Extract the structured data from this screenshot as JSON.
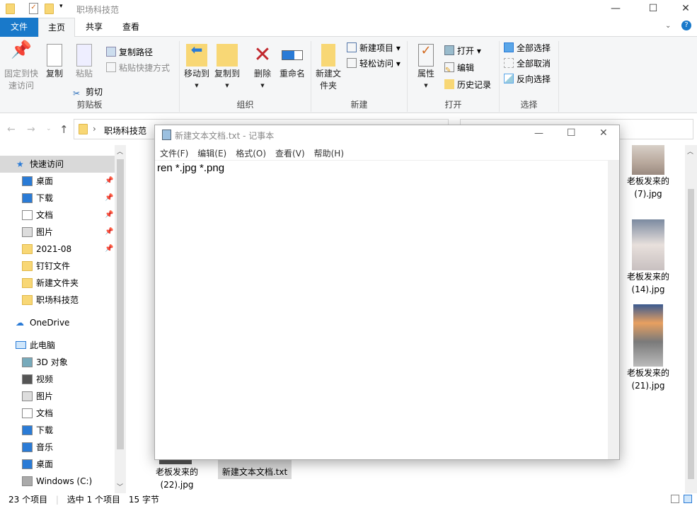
{
  "window": {
    "title": "职场科技范",
    "minimize": "—",
    "maximize": "☐",
    "close": "✕"
  },
  "tabs": [
    "文件",
    "主页",
    "共享",
    "查看"
  ],
  "ribbon": {
    "clipboard": {
      "label": "剪贴板",
      "pin": "固定到快速访问",
      "copy": "复制",
      "paste": "粘贴",
      "copy_path": "复制路径",
      "paste_shortcut": "粘贴快捷方式",
      "cut": "剪切"
    },
    "organize": {
      "label": "组织",
      "move_to": "移动到",
      "copy_to": "复制到",
      "delete": "删除",
      "rename": "重命名"
    },
    "new": {
      "label": "新建",
      "new_folder": "新建文件夹",
      "new_item": "新建项目",
      "easy_access": "轻松访问"
    },
    "open": {
      "label": "打开",
      "properties": "属性",
      "open": "打开",
      "edit": "编辑",
      "history": "历史记录"
    },
    "select": {
      "label": "选择",
      "select_all": "全部选择",
      "select_none": "全部取消",
      "invert": "反向选择"
    }
  },
  "address": {
    "path": "职场科技范"
  },
  "nav": {
    "quick_access": "快速访问",
    "quick_items": [
      {
        "label": "桌面",
        "pinned": true
      },
      {
        "label": "下载",
        "pinned": true
      },
      {
        "label": "文档",
        "pinned": true
      },
      {
        "label": "图片",
        "pinned": true
      },
      {
        "label": "2021-08",
        "pinned": true
      },
      {
        "label": "钉钉文件"
      },
      {
        "label": "新建文件夹"
      },
      {
        "label": "职场科技范"
      }
    ],
    "onedrive": "OneDrive",
    "this_pc": "此电脑",
    "pc_items": [
      "3D 对象",
      "视频",
      "图片",
      "文档",
      "下载",
      "音乐",
      "桌面",
      "Windows (C:)"
    ]
  },
  "files": [
    {
      "name1": "老板发来的",
      "name2": "(7).jpg"
    },
    {
      "name1": "老板发来的",
      "name2": "(14).jpg"
    },
    {
      "name1": "老板发来的",
      "name2": "(21).jpg"
    },
    {
      "name1": "老板发来的",
      "name2": "(22).jpg"
    },
    {
      "name1": "新建文本文档.txt"
    }
  ],
  "notepad": {
    "title": "新建文本文档.txt - 记事本",
    "menu": [
      "文件(F)",
      "编辑(E)",
      "格式(O)",
      "查看(V)",
      "帮助(H)"
    ],
    "content": "ren *.jpg *.png"
  },
  "status": {
    "count": "23 个项目",
    "selected": "选中 1 个项目",
    "size": "15 字节"
  }
}
